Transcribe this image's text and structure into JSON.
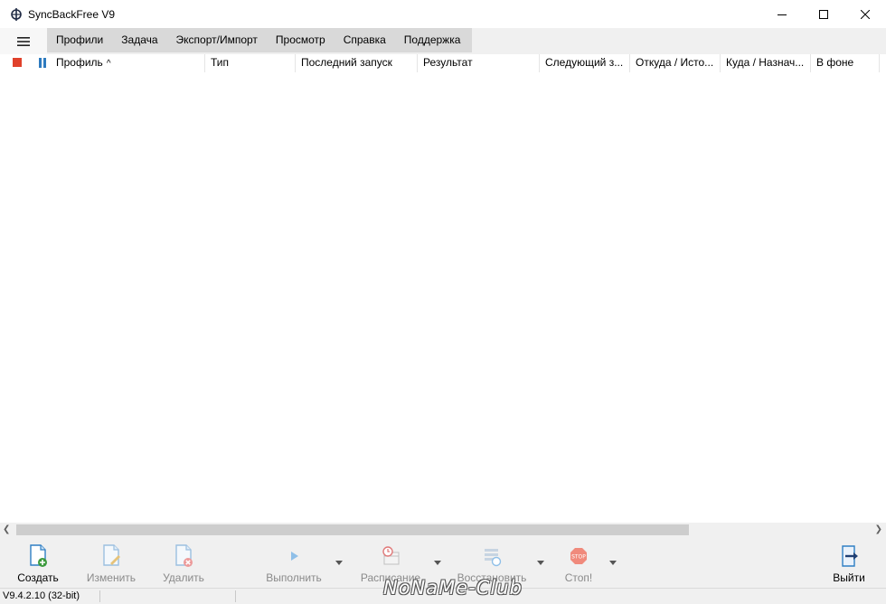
{
  "window": {
    "title": "SyncBackFree V9",
    "controls": [
      "minimize",
      "maximize",
      "close"
    ]
  },
  "menu": {
    "items": [
      "Профили",
      "Задача",
      "Экспорт/Импорт",
      "Просмотр",
      "Справка",
      "Поддержка"
    ]
  },
  "grid": {
    "columns": [
      "Профиль",
      "Тип",
      "Последний запуск",
      "Результат",
      "Следующий з...",
      "Откуда / Исто...",
      "Куда / Назнач...",
      "В фоне"
    ],
    "sort_indicator": "^",
    "rows": []
  },
  "toolbar": {
    "buttons": [
      {
        "label": "Создать",
        "icon": "new-profile-icon",
        "enabled": true
      },
      {
        "label": "Изменить",
        "icon": "edit-profile-icon",
        "enabled": false
      },
      {
        "label": "Удалить",
        "icon": "delete-profile-icon",
        "enabled": false
      },
      {
        "label": "Выполнить",
        "icon": "run-icon",
        "enabled": false
      },
      {
        "label": "Расписание",
        "icon": "schedule-icon",
        "enabled": false
      },
      {
        "label": "Восстановить",
        "icon": "restore-icon",
        "enabled": false
      },
      {
        "label": "Стоп!",
        "icon": "stop-sign-icon",
        "enabled": false
      },
      {
        "label": "Выйти",
        "icon": "exit-icon",
        "enabled": true
      }
    ]
  },
  "status": {
    "version": "V9.4.2.10 (32-bit)"
  },
  "watermark": "NoNaMe-Club",
  "colors": {
    "menubar": "#f0f0f0",
    "menu_strip": "#d9d9d9",
    "stop_red": "#e0412b",
    "pause_blue": "#2e7bbf",
    "scroll_thumb": "#cdcdcd"
  }
}
